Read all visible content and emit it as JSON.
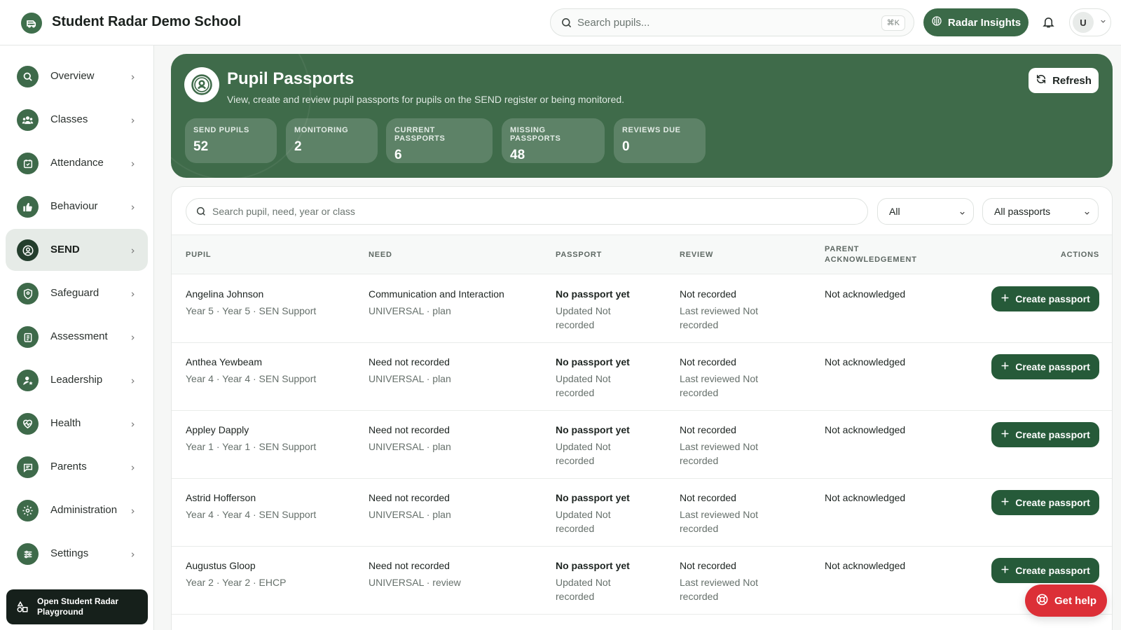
{
  "header": {
    "school_name": "Student Radar Demo School",
    "search_placeholder": "Search pupils...",
    "search_shortcut": "⌘K",
    "insights_label": "Radar Insights",
    "user_initial": "U"
  },
  "sidebar": {
    "items": [
      {
        "label": "Overview",
        "icon": "search-icon"
      },
      {
        "label": "Classes",
        "icon": "users-icon"
      },
      {
        "label": "Attendance",
        "icon": "calendar-check-icon"
      },
      {
        "label": "Behaviour",
        "icon": "thumbs-up-icon"
      },
      {
        "label": "SEND",
        "icon": "user-circle-icon",
        "active": true
      },
      {
        "label": "Safeguard",
        "icon": "shield-user-icon"
      },
      {
        "label": "Assessment",
        "icon": "clipboard-list-icon"
      },
      {
        "label": "Leadership",
        "icon": "user-star-icon"
      },
      {
        "label": "Health",
        "icon": "heart-pulse-icon"
      },
      {
        "label": "Parents",
        "icon": "message-icon"
      },
      {
        "label": "Administration",
        "icon": "gear-icon"
      },
      {
        "label": "Settings",
        "icon": "sliders-icon"
      }
    ],
    "playground_label": "Open Student Radar Playground"
  },
  "hero": {
    "title": "Pupil Passports",
    "subtitle": "View, create and review pupil passports for pupils on the SEND register or being monitored.",
    "refresh_label": "Refresh",
    "stats": [
      {
        "label": "SEND PUPILS",
        "value": "52"
      },
      {
        "label": "MONITORING",
        "value": "2"
      },
      {
        "label": "CURRENT PASSPORTS",
        "value": "6"
      },
      {
        "label": "MISSING PASSPORTS",
        "value": "48"
      },
      {
        "label": "REVIEWS DUE",
        "value": "0"
      }
    ]
  },
  "filters": {
    "search_placeholder": "Search pupil, need, year or class",
    "status_value": "All",
    "passport_value": "All passports"
  },
  "table": {
    "headers": {
      "pupil": "PUPIL",
      "need": "NEED",
      "passport": "PASSPORT",
      "review": "REVIEW",
      "parent_1": "PARENT",
      "parent_2": "ACKNOWLEDGEMENT",
      "actions": "ACTIONS"
    },
    "rows": [
      {
        "name": "Angelina Johnson",
        "meta": "Year 5 · Year 5 · SEN Support",
        "need": "Communication and Interaction",
        "need_sub": "UNIVERSAL · plan",
        "passport": "No passport yet",
        "passport_sub": "Updated Not recorded",
        "review": "Not recorded",
        "review_sub": "Last reviewed Not recorded",
        "ack": "Not acknowledged",
        "action": "Create passport"
      },
      {
        "name": "Anthea Yewbeam",
        "meta": "Year 4 · Year 4 · SEN Support",
        "need": "Need not recorded",
        "need_sub": "UNIVERSAL · plan",
        "passport": "No passport yet",
        "passport_sub": "Updated Not recorded",
        "review": "Not recorded",
        "review_sub": "Last reviewed Not recorded",
        "ack": "Not acknowledged",
        "action": "Create passport"
      },
      {
        "name": "Appley Dapply",
        "meta": "Year 1 · Year 1 · SEN Support",
        "need": "Need not recorded",
        "need_sub": "UNIVERSAL · plan",
        "passport": "No passport yet",
        "passport_sub": "Updated Not recorded",
        "review": "Not recorded",
        "review_sub": "Last reviewed Not recorded",
        "ack": "Not acknowledged",
        "action": "Create passport"
      },
      {
        "name": "Astrid Hofferson",
        "meta": "Year 4 · Year 4 · SEN Support",
        "need": "Need not recorded",
        "need_sub": "UNIVERSAL · plan",
        "passport": "No passport yet",
        "passport_sub": "Updated Not recorded",
        "review": "Not recorded",
        "review_sub": "Last reviewed Not recorded",
        "ack": "Not acknowledged",
        "action": "Create passport"
      },
      {
        "name": "Augustus Gloop",
        "meta": "Year 2 · Year 2 · EHCP",
        "need": "Need not recorded",
        "need_sub": "UNIVERSAL · review",
        "passport": "No passport yet",
        "passport_sub": "Updated Not recorded",
        "review": "Not recorded",
        "review_sub": "Last reviewed Not recorded",
        "ack": "Not acknowledged",
        "action": "Create passport"
      }
    ]
  },
  "help_label": "Get help",
  "colors": {
    "brand": "#3f6b4a",
    "button": "#265a39",
    "help": "#dc2f37"
  }
}
